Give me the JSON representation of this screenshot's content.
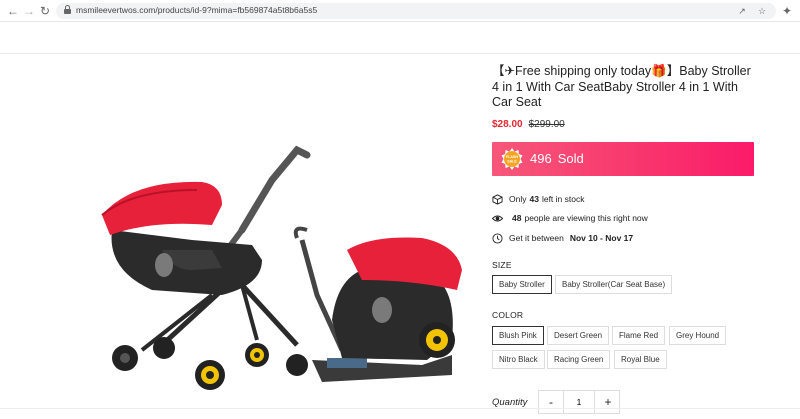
{
  "browser": {
    "url": "msmileevertwos.com/products/id-9?mima=fb569874a5t8b6a5s5",
    "icons": [
      "back-icon",
      "forward-icon",
      "reload-icon",
      "lock-icon",
      "share-icon",
      "star-icon",
      "extensions-icon"
    ]
  },
  "product": {
    "title": "【✈Free shipping only today🎁】Baby Stroller 4 in 1 With Car SeatBaby Stroller 4 in 1 With Car Seat",
    "price": "$28.00",
    "compare_price": "$299.00",
    "flash_badge_line1": "FLASH",
    "flash_badge_line2": "SALE",
    "flash_count": "496",
    "flash_label": "Sold",
    "stock_prefix": "Only",
    "stock_count": "43",
    "stock_suffix": "left in stock",
    "viewers_count": "48",
    "viewers_text": "people are viewing this right now",
    "delivery_prefix": "Get it between",
    "delivery_range": "Nov 10 - Nov 17"
  },
  "size": {
    "label": "SIZE",
    "options": [
      "Baby Stroller",
      "Baby Stroller(Car Seat Base)"
    ],
    "selected": "Baby Stroller"
  },
  "color": {
    "label": "COLOR",
    "options": [
      "Blush Pink",
      "Desert Green",
      "Flame Red",
      "Grey Hound",
      "Nitro Black",
      "Racing Green",
      "Royal Blue"
    ],
    "selected": "Blush Pink"
  },
  "quantity": {
    "label": "Quantity",
    "minus": "-",
    "value": "1",
    "plus": "+"
  },
  "colors": {
    "accent_red": "#e4262e",
    "flash_gradient_start": "#f7577a",
    "flash_gradient_end": "#fb1a6a",
    "canopy_red": "#e8213b",
    "wheel_yellow": "#f2c400"
  }
}
